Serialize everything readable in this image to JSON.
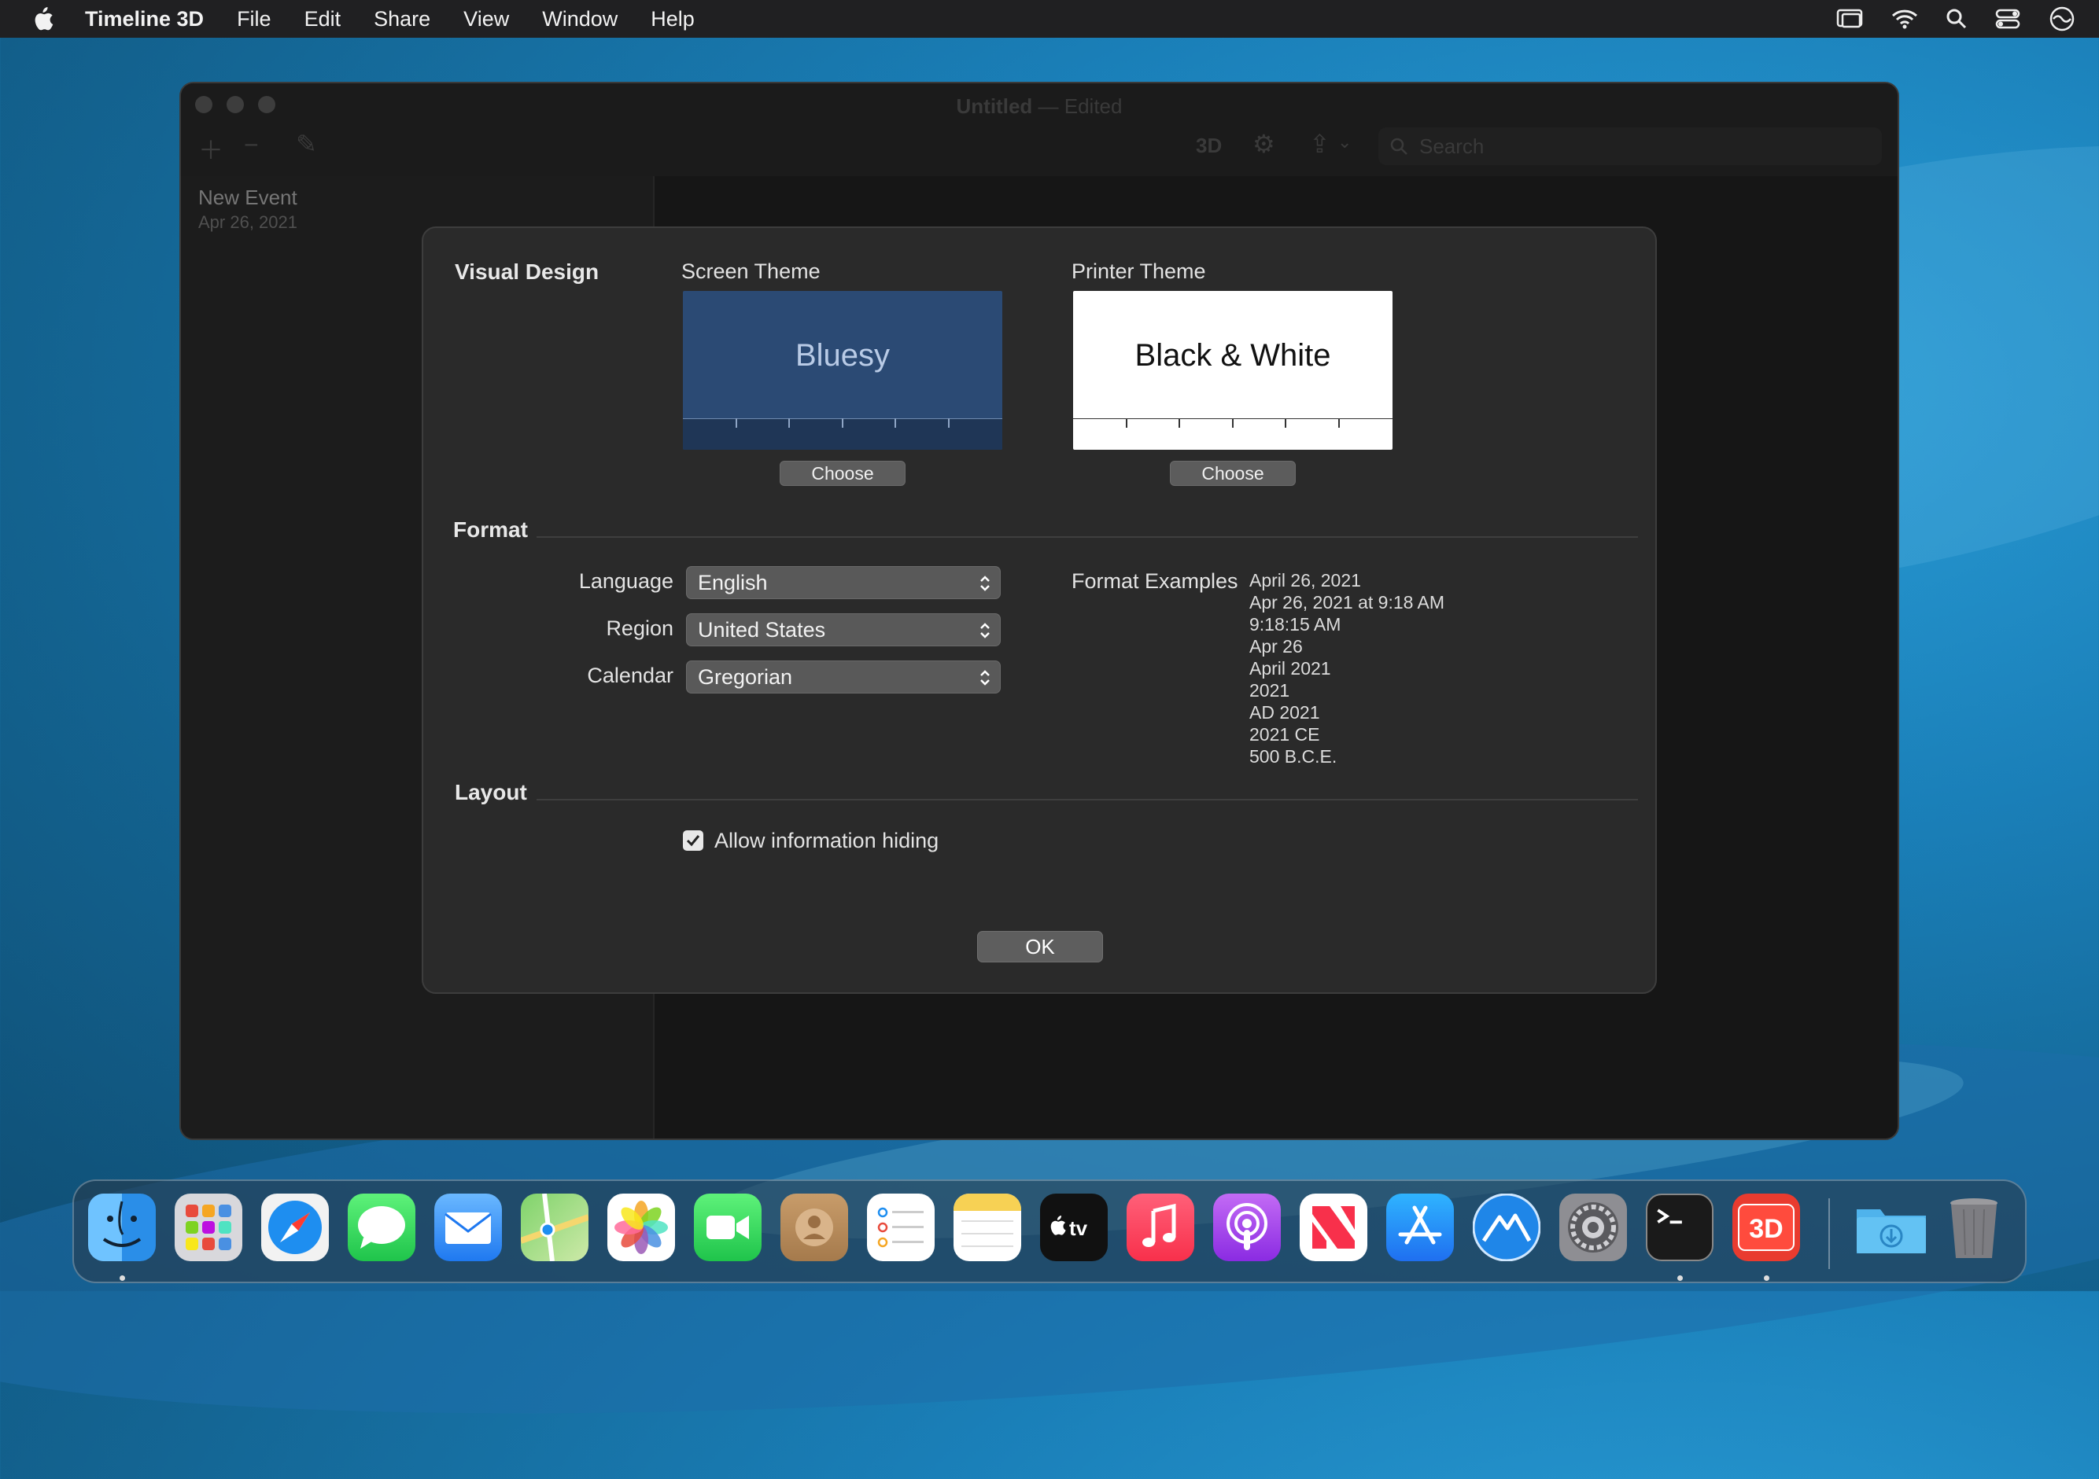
{
  "menubar": {
    "app_name": "Timeline 3D",
    "items": [
      "File",
      "Edit",
      "Share",
      "View",
      "Window",
      "Help"
    ]
  },
  "window": {
    "title": "Untitled",
    "title_separator": "—",
    "title_status": "Edited",
    "toolbar_3d": "3D",
    "search_placeholder": "Search",
    "sidebar_event": {
      "title": "New Event",
      "date": "Apr 26, 2021"
    }
  },
  "sheet": {
    "visual_design": {
      "heading": "Visual Design",
      "screen_theme": {
        "label": "Screen Theme",
        "name": "Bluesy",
        "button": "Choose",
        "bg_color": "#2b4a74"
      },
      "printer_theme": {
        "label": "Printer Theme",
        "name": "Black & White",
        "button": "Choose",
        "bg_color": "#ffffff"
      }
    },
    "format": {
      "heading": "Format",
      "language": {
        "label": "Language",
        "value": "English"
      },
      "region": {
        "label": "Region",
        "value": "United States"
      },
      "calendar": {
        "label": "Calendar",
        "value": "Gregorian"
      },
      "examples_label": "Format Examples",
      "examples": [
        "April 26, 2021",
        "Apr 26, 2021 at 9:18 AM",
        "9:18:15 AM",
        "Apr 26",
        "April 2021",
        "2021",
        "AD 2021",
        "2021 CE",
        "500 B.C.E."
      ]
    },
    "layout": {
      "heading": "Layout",
      "allow_hiding_label": "Allow information hiding",
      "allow_hiding_checked": true
    },
    "ok_label": "OK"
  },
  "dock": {
    "apps": [
      "Finder",
      "Launchpad",
      "Safari",
      "Messages",
      "Mail",
      "Maps",
      "Photos",
      "FaceTime",
      "Contacts",
      "Reminders",
      "Notes",
      "Apple TV",
      "Music",
      "Podcasts",
      "News",
      "App Store",
      "Timeline 3D Companion",
      "System Preferences",
      "Terminal",
      "Timeline 3D"
    ],
    "appletv_text": "tv",
    "timeline_text": "3D",
    "downloads": "Downloads",
    "trash": "Trash"
  }
}
